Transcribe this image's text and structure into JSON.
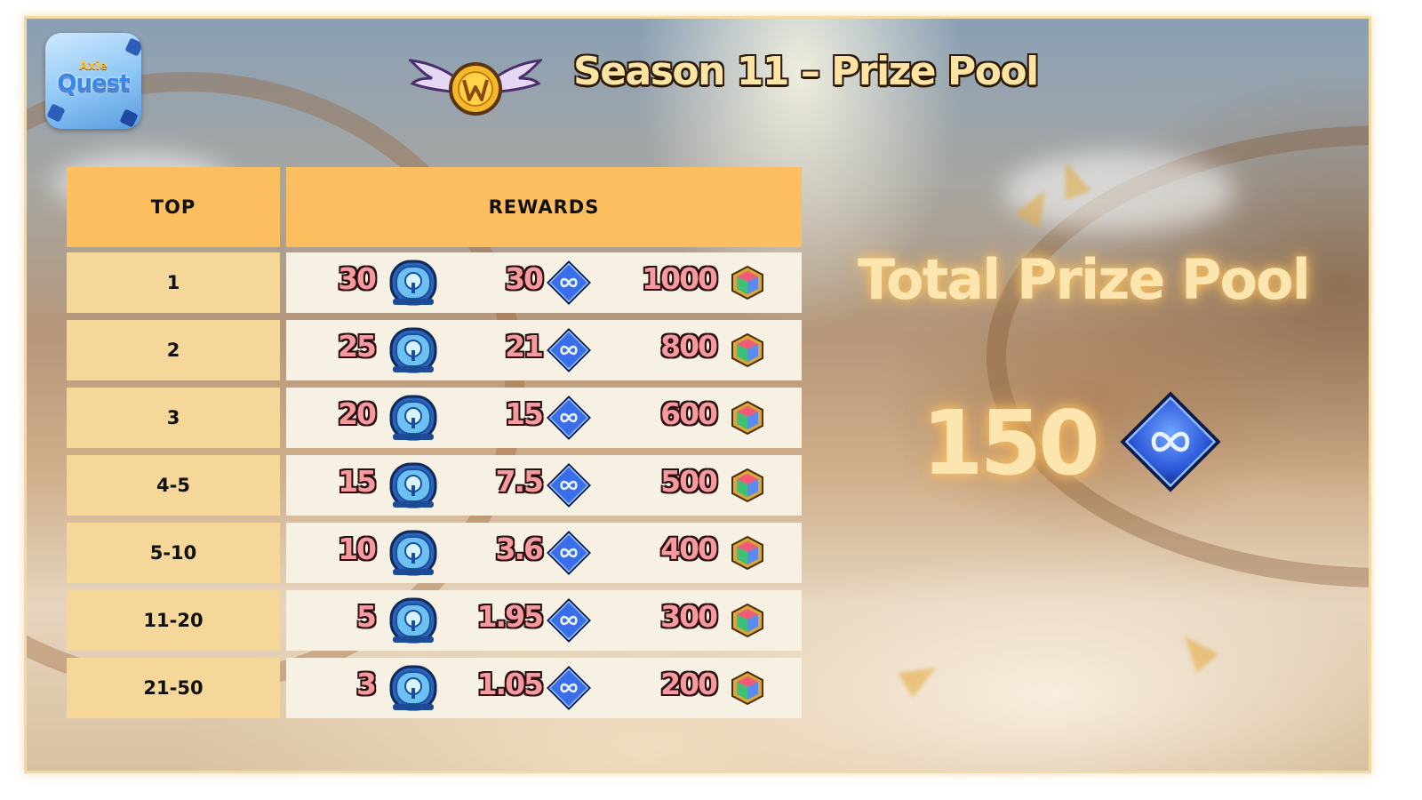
{
  "app_logo": {
    "small_text": "Axie",
    "big_text": "Quest",
    "icon": "axie-quest-app-icon"
  },
  "season_badge": {
    "icon": "winged-season-badge-icon"
  },
  "header": {
    "title": "Season 11 – Prize Pool"
  },
  "table": {
    "columns": [
      "TOP",
      "REWARDS"
    ],
    "reward_icons": [
      "blue-chest-icon",
      "axs-token-icon",
      "rainbow-cube-icon"
    ],
    "rows": [
      {
        "rank": "1",
        "chests": "30",
        "axs": "30",
        "cubes": "1000"
      },
      {
        "rank": "2",
        "chests": "25",
        "axs": "21",
        "cubes": "800"
      },
      {
        "rank": "3",
        "chests": "20",
        "axs": "15",
        "cubes": "600"
      },
      {
        "rank": "4-5",
        "chests": "15",
        "axs": "7.5",
        "cubes": "500"
      },
      {
        "rank": "5-10",
        "chests": "10",
        "axs": "3.6",
        "cubes": "400"
      },
      {
        "rank": "11-20",
        "chests": "5",
        "axs": "1.95",
        "cubes": "300"
      },
      {
        "rank": "21-50",
        "chests": "3",
        "axs": "1.05",
        "cubes": "200"
      }
    ]
  },
  "total": {
    "label": "Total Prize Pool",
    "value": "150",
    "icon": "axs-token-icon"
  },
  "colors": {
    "header_bg": "#fdbe5f",
    "rank_bg": "#f5d79a",
    "reward_bg": "#f6f1e3",
    "number_pink": "#f79aa0",
    "title_cream": "#fde3a4",
    "axs_blue": "#2e5fe0"
  }
}
